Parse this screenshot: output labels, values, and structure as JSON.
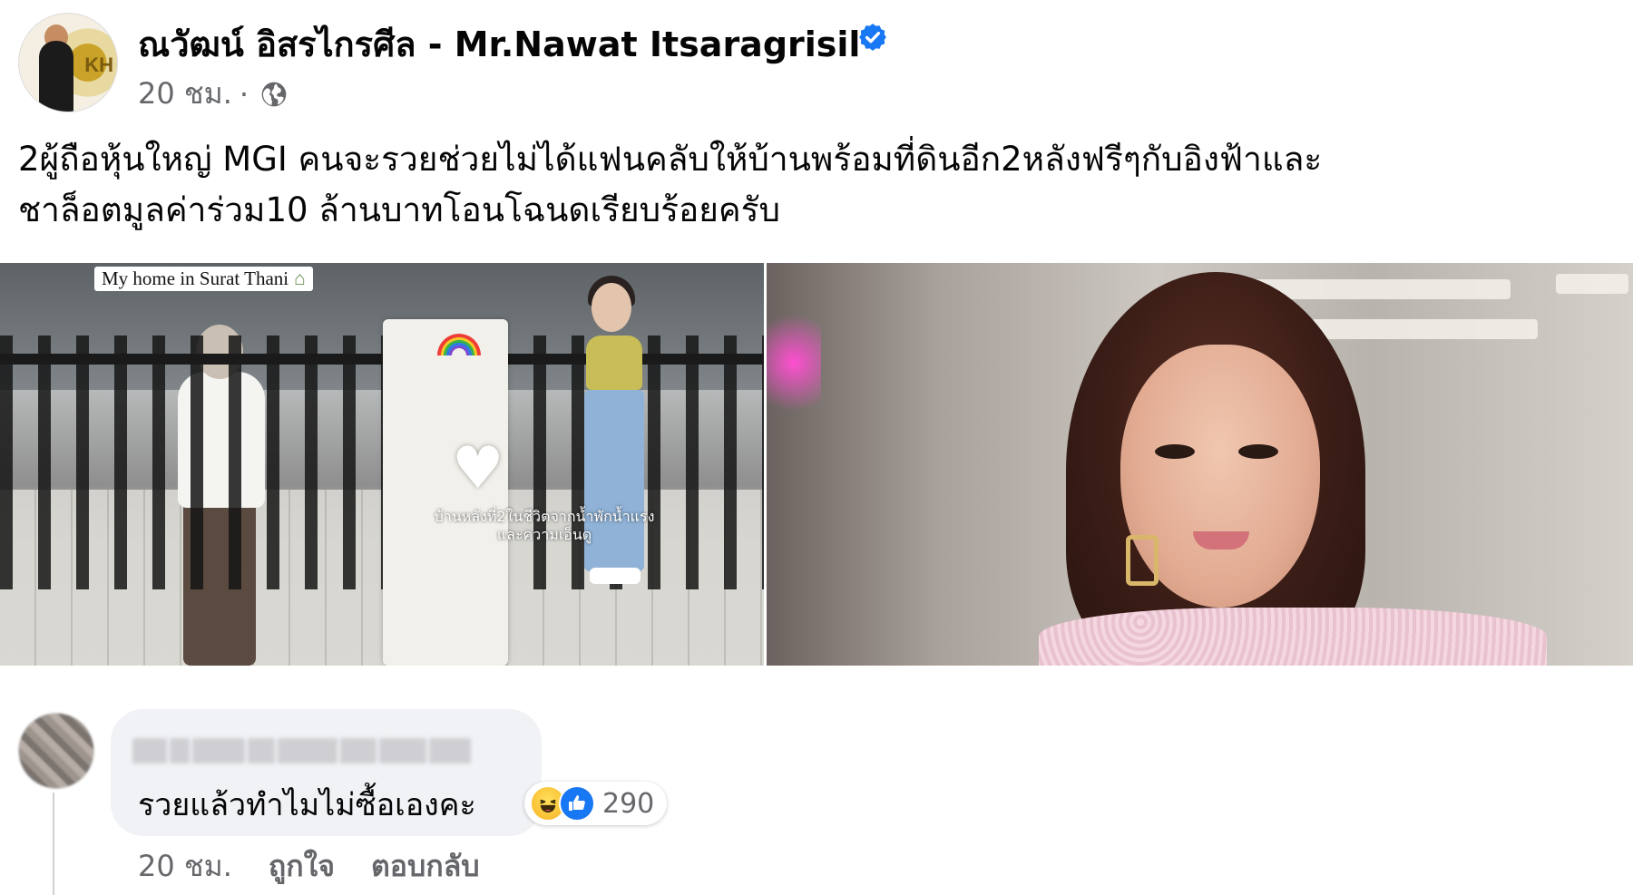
{
  "post": {
    "author": "ณวัฒน์ อิสรไกรศีล - Mr.Nawat Itsaragrisil",
    "time": "20 ชม.",
    "separator": "·",
    "text_lines": [
      "2ผู้ถือหุ้นใหญ่ MGI คนจะรวยช่วยไม่ได้แฟนคลับให้บ้านพร้อมที่ดินอีก2หลังฟรีๆกับอิงฟ้าและ",
      "ชาล็อตมูลค่าร่วม10 ล้านบาทโอนโฉนดเรียบร้อยครับ"
    ]
  },
  "photos": {
    "left_caption": "My home in Surat Thani",
    "overlay_line1": "บ้านหลังที่2ในชีวิตจากน้ำพักน้ำแรง",
    "overlay_line2": "และความเอ็นดู"
  },
  "comment": {
    "text": "รวยแล้วทำไมไม่ซื้อเองคะ",
    "reaction_count": "290",
    "time": "20 ชม.",
    "like_label": "ถูกใจ",
    "reply_label": "ตอบกลับ"
  },
  "icons": {
    "verified": "verified-badge-icon",
    "audience": "globe-icon",
    "reaction1": "haha-icon",
    "reaction2": "like-icon"
  },
  "colors": {
    "verified": "#1877f2",
    "meta_text": "#65676b",
    "bubble_bg": "#f0f2f5",
    "like_blue": "#1877f2"
  }
}
